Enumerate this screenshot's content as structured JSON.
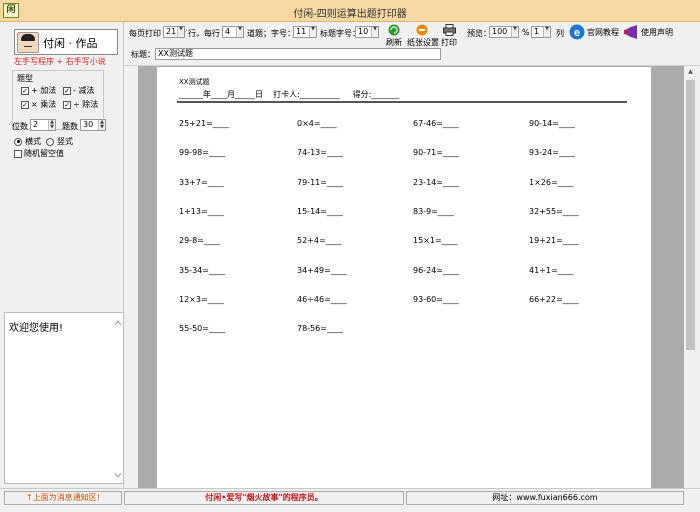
{
  "window": {
    "title": "付闲-四则运算出题打印器",
    "icon_text": "闲"
  },
  "logo": {
    "brand": "付闲 · 作品",
    "slogan": "左手写程序 + 右手写小说"
  },
  "operations": {
    "group_label": "题型",
    "items": [
      {
        "label": "+ 加法",
        "checked": true
      },
      {
        "label": "- 减法",
        "checked": true
      },
      {
        "label": "× 乘法",
        "checked": true
      },
      {
        "label": "÷ 除法",
        "checked": true
      }
    ]
  },
  "settings": {
    "digits_label": "位数",
    "digits_value": "2",
    "count_label": "题数",
    "count_value": "30",
    "horizontal_label": "横式",
    "vertical_label": "竖式",
    "random_blank_label": "随机留空值",
    "layout_selected": "horizontal"
  },
  "welcome_text": "欢迎您使用!",
  "toolbar": {
    "per_page_label": "每页打印",
    "per_page_value": "21",
    "row_label": "行，每行",
    "per_row_value": "4",
    "problem_label": "道题；字号：",
    "font_size_value": "11",
    "title_font_label": "标题字号：",
    "title_font_value": "10",
    "refresh_label": "刷新",
    "paper_label": "纸张设置",
    "print_label": "打印",
    "preview_label": "预览：",
    "zoom_value": "100",
    "zoom_unit": "%",
    "cols_value": "1",
    "cols_label": "列",
    "tutorial_label": "官网教程",
    "statement_label": "使用声明",
    "title_field_label": "标题：",
    "title_field_value": "XX测试题"
  },
  "paper": {
    "heading": "XX测试题",
    "info_line": "______年____月_____日    打卡人:__________     得分:_______",
    "problems": [
      "25+21=____",
      "0×4=____",
      "67-46=____",
      "90-14=____",
      "99-98=____",
      "74-13=____",
      "90-71=____",
      "93-24=____",
      "33+7=____",
      "79-11=____",
      "23-14=____",
      "1×26=____",
      "1+13=____",
      "15-14=____",
      "83-9=____",
      "32+55=____",
      "29-8=____",
      "52+4=____",
      "15×1=____",
      "19+21=____",
      "35-34=____",
      "34+49=____",
      "96-24=____",
      "41÷1=____",
      "12×3=____",
      "46÷46=____",
      "93-60=____",
      "66+22=____",
      "55-50=____",
      "78-56=____"
    ]
  },
  "status": {
    "left": "↑上面为消息通知区!",
    "center": "付闲•爱写\"烟火故事\"的程序员。",
    "right": "网址：www.fuxian666.com"
  }
}
